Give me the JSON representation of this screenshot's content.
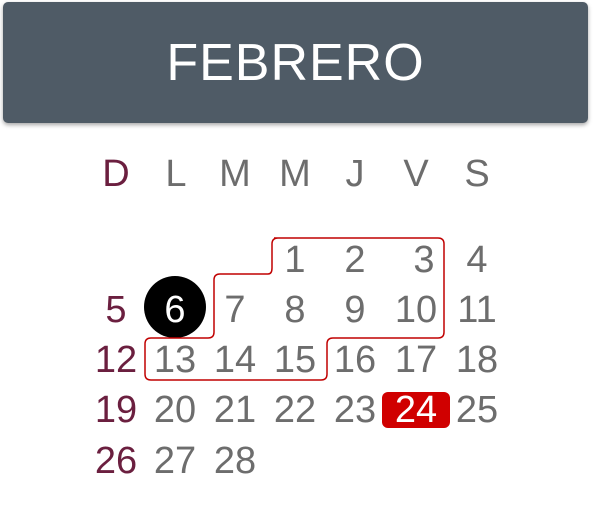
{
  "header": {
    "month": "FEBRERO"
  },
  "weekdays": [
    "D",
    "L",
    "M",
    "M",
    "J",
    "V",
    "S"
  ],
  "weeks": [
    [
      "",
      "",
      "",
      "",
      "1",
      "2",
      "3",
      "4"
    ],
    [
      "5",
      "6",
      "7",
      "8",
      "9",
      "10",
      "11"
    ],
    [
      "12",
      "13",
      "14",
      "15",
      "16",
      "17",
      "18"
    ],
    [
      "19",
      "20",
      "21",
      "22",
      "23",
      "24",
      "25"
    ],
    [
      "26",
      "27",
      "28",
      "",
      "",
      "",
      ""
    ]
  ],
  "colors": {
    "header_bg": "#4f5b66",
    "sunday": "#6b1f3f",
    "weekday": "#6d6d6d",
    "today_circle": "#000000",
    "holiday_box": "#d00000",
    "range_outline": "#c00000"
  },
  "markers": {
    "circled_day": "6",
    "highlighted_day": "24",
    "outlined_range": [
      "1",
      "2",
      "3",
      "7",
      "8",
      "9",
      "10",
      "13",
      "14",
      "15"
    ]
  }
}
